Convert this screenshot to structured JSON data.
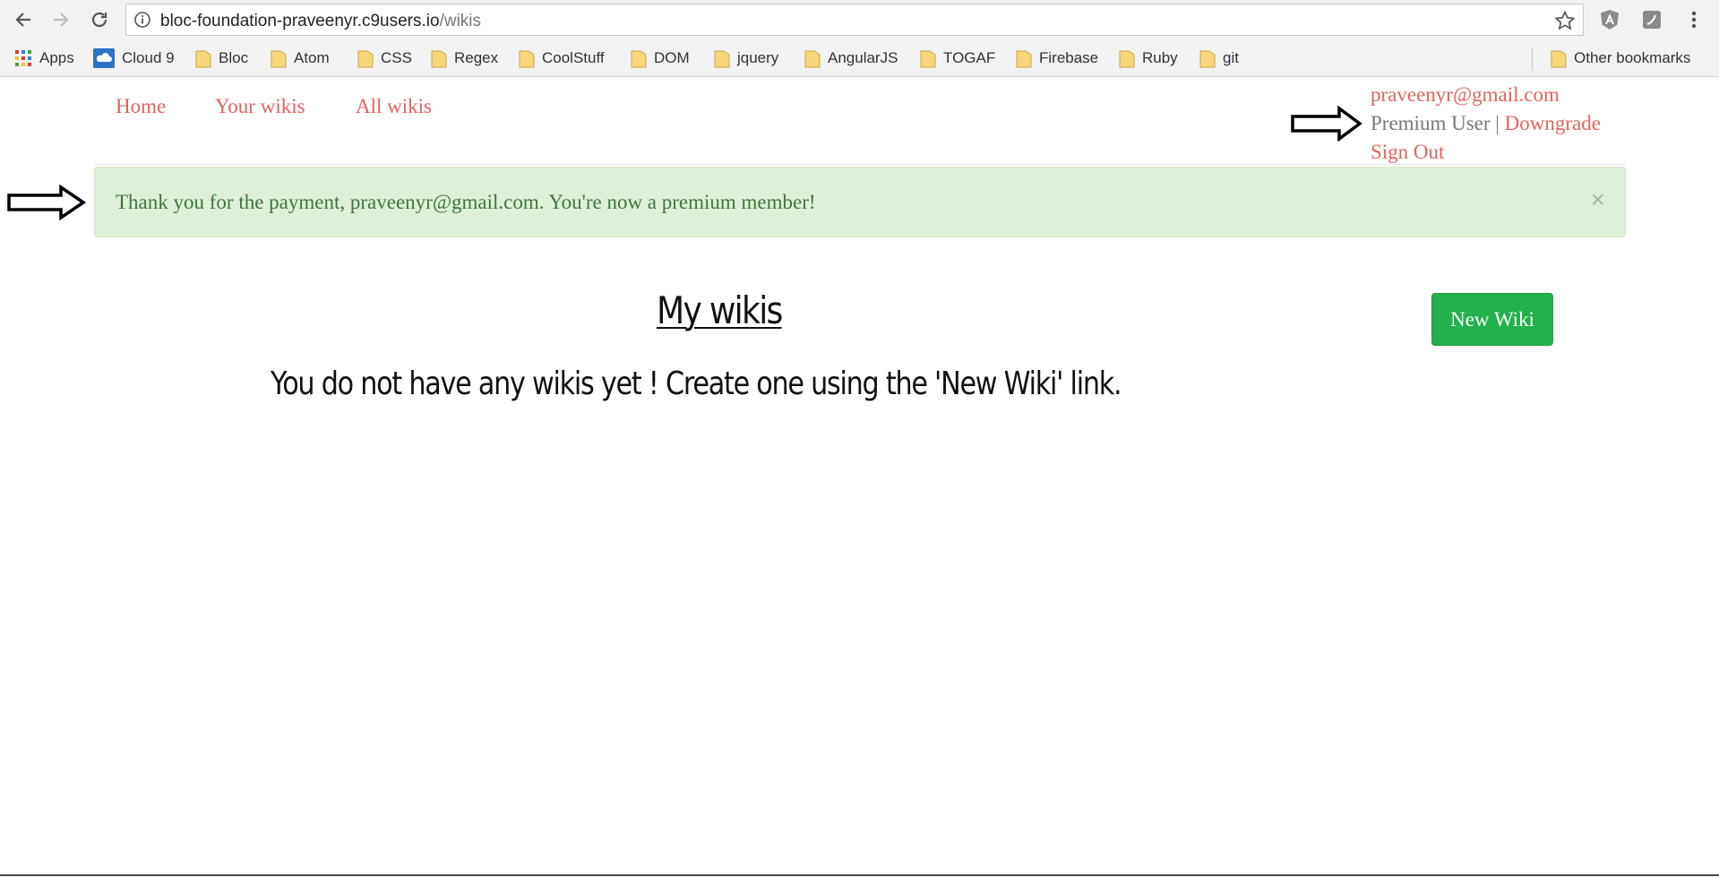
{
  "browser": {
    "url_host": "bloc-foundation-praveenyr.c9users.io",
    "url_path": "/wikis",
    "bookmarks": [
      {
        "label": "Apps",
        "icon": "apps-grid-icon"
      },
      {
        "label": "Cloud 9",
        "icon": "cloud9-icon"
      },
      {
        "label": "Bloc",
        "icon": "folder-icon"
      },
      {
        "label": "Atom",
        "icon": "folder-icon"
      },
      {
        "label": "CSS",
        "icon": "folder-icon"
      },
      {
        "label": "Regex",
        "icon": "folder-icon"
      },
      {
        "label": "CoolStuff",
        "icon": "folder-icon"
      },
      {
        "label": "DOM",
        "icon": "folder-icon"
      },
      {
        "label": "jquery",
        "icon": "folder-icon"
      },
      {
        "label": "AngularJS",
        "icon": "folder-icon"
      },
      {
        "label": "TOGAF",
        "icon": "folder-icon"
      },
      {
        "label": "Firebase",
        "icon": "folder-icon"
      },
      {
        "label": "Ruby",
        "icon": "folder-icon"
      },
      {
        "label": "git",
        "icon": "folder-icon"
      }
    ],
    "other_bookmarks": "Other bookmarks"
  },
  "nav": {
    "home": "Home",
    "your_wikis": "Your wikis",
    "all_wikis": "All wikis"
  },
  "user": {
    "email": "praveenyr@gmail.com",
    "plan": "Premium User |",
    "downgrade": "Downgrade",
    "sign_out": "Sign Out"
  },
  "alert": {
    "message": "Thank you for the payment, praveenyr@gmail.com. You're now a premium member!",
    "close": "×"
  },
  "main": {
    "title": "My wikis",
    "new_wiki": "New Wiki",
    "empty_message": "You do not have any wikis yet ! Create one using the 'New Wiki' link."
  },
  "colors": {
    "link": "#e2635f",
    "alert_bg": "#dff0d8",
    "alert_text": "#3c763d",
    "button": "#22b14c"
  }
}
